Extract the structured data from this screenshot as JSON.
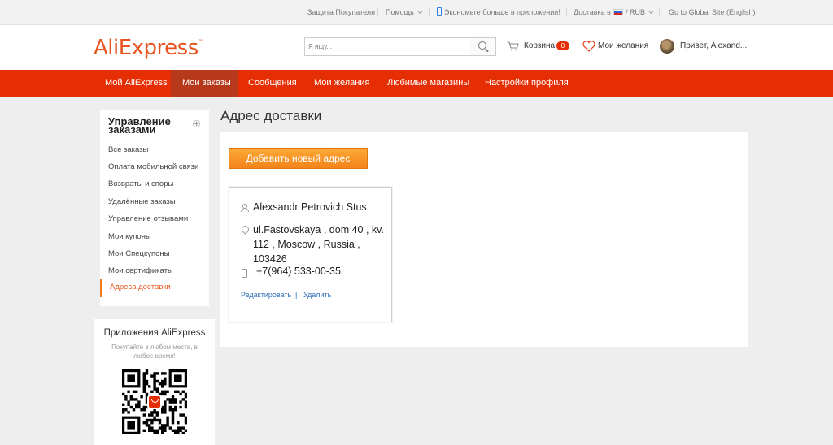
{
  "topbar": {
    "buyer_protection": "Защита Покупателя",
    "help": "Помощь",
    "app_promo": "Экономьте больше в приложении!",
    "ship_to": "Доставка в",
    "currency": "/  RUB",
    "global_site": "Go to Global Site (English)"
  },
  "header": {
    "logo": "AliExpress",
    "search_placeholder": "Я ищу...",
    "cart_label": "Корзина",
    "cart_count": "0",
    "wishlist_label": "Мои желания",
    "greeting": "Привет, Alexand..."
  },
  "nav": {
    "tabs": [
      {
        "label": "Мой AliExpress"
      },
      {
        "label": "Мои заказы",
        "active": true
      },
      {
        "label": "Сообщения"
      },
      {
        "label": "Мои желания"
      },
      {
        "label": "Любимые магазины"
      },
      {
        "label": "Настройки профиля"
      }
    ]
  },
  "sidebar": {
    "title": "Управление заказами",
    "items": [
      {
        "label": "Все заказы"
      },
      {
        "label": "Оплата мобильной связи"
      },
      {
        "label": "Возвраты и споры"
      },
      {
        "label": "Удалённые заказы"
      },
      {
        "label": "Управление отзывами"
      },
      {
        "label": "Мои купоны"
      },
      {
        "label": "Мои Спецкупоны"
      },
      {
        "label": "Мои сертификаты"
      },
      {
        "label": "Адреса доставки",
        "active": true
      }
    ]
  },
  "apps": {
    "title": "Приложения AliExpress",
    "subtitle": "Покупайте в любом месте, в любое время!"
  },
  "main": {
    "title": "Адрес доставки",
    "add_button": "Добавить новый адрес",
    "address_card": {
      "name": "Alexsandr Petrovich Stus",
      "address": "ul.Fastovskaya , dom 40 , kv. 112 , Moscow , Russia , 103426",
      "phone": "+7(964) 533-00-35",
      "edit_link": "Редактировать",
      "separator": "|",
      "delete_link": "Удалить"
    }
  },
  "colors": {
    "brand_red": "#e62e04",
    "nav_active": "#b6391b",
    "button_orange": "#f5901f",
    "link_blue": "#2f6fb5",
    "active_orange": "#e8531f"
  }
}
